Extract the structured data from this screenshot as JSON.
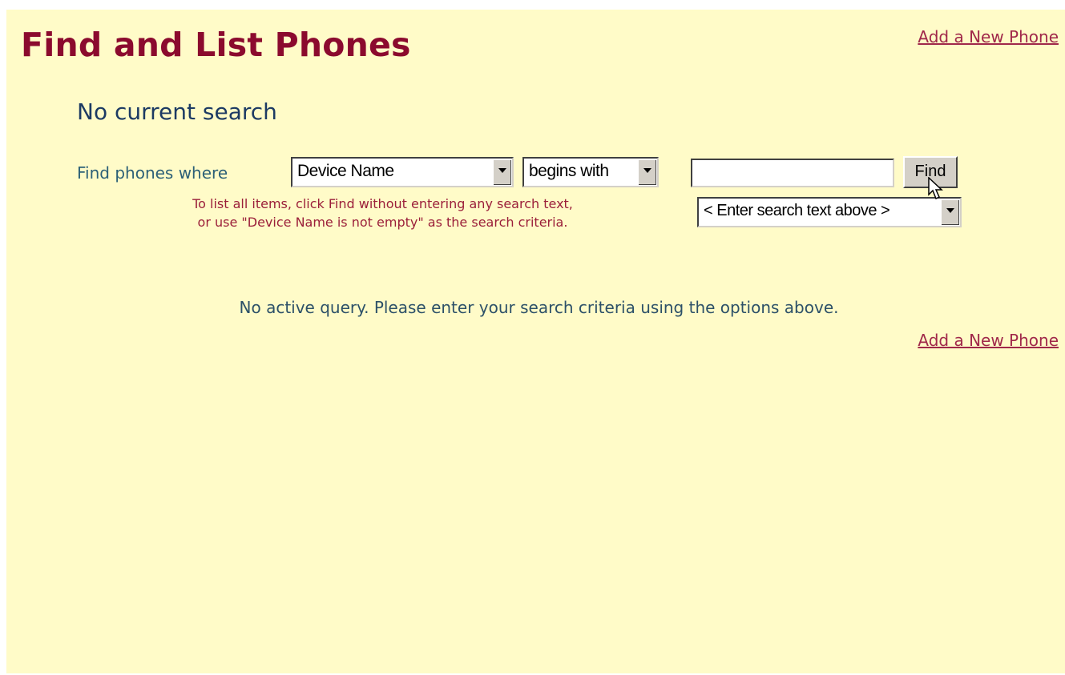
{
  "page": {
    "title": "Find and List Phones",
    "add_link_top": "Add a New Phone",
    "add_link_bottom": "Add a New Phone",
    "status": "No current search"
  },
  "search": {
    "label": "Find phones where",
    "field_select": "Device Name",
    "operator_select": "begins with",
    "text_value": "",
    "find_button": "Find",
    "hint_select": "< Enter search text above >",
    "note_line1": "To list all items, click Find without entering any search text,",
    "note_line2": "or use \"Device Name is not empty\" as the search criteria."
  },
  "results": {
    "message": "No active query. Please enter your search criteria using the options above."
  },
  "colors": {
    "background": "#fffbc8",
    "title": "#8b0a2e",
    "link": "#a0284a",
    "status": "#1c3a63"
  },
  "icons": [
    "chevron-down-icon",
    "mouse-pointer-icon"
  ]
}
